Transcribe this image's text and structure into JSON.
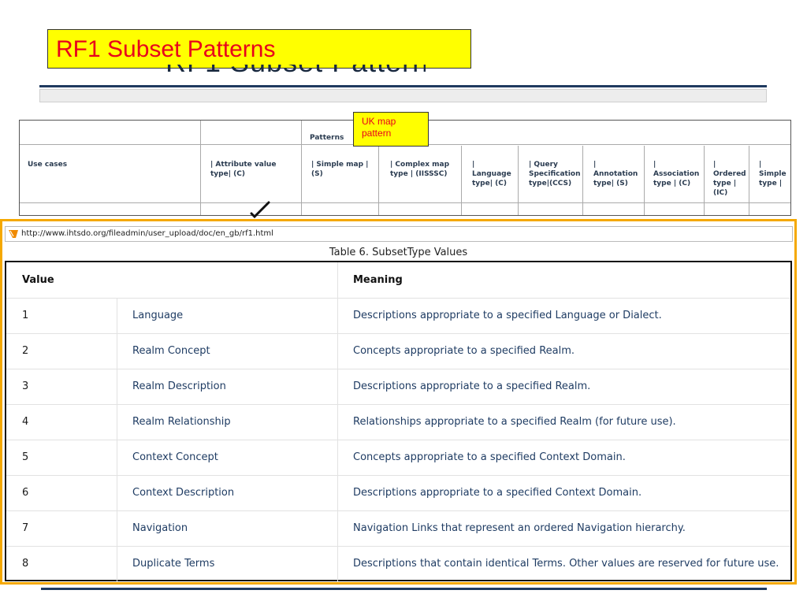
{
  "slide": {
    "title": "RF1 Subset Patterns",
    "colors": {
      "highlight": "#ffff00",
      "title_text": "#e8001c",
      "frame": "#f5a800",
      "rule": "#1f3a5f"
    }
  },
  "patterns_table": {
    "group_header": "Patterns",
    "headers": [
      "Use cases",
      "| Attribute value type| (C)",
      "| Simple map | (S)",
      "| Complex map type | (IISSSC)",
      "| Language type| (C)",
      "| Query Specification type|(CCS)",
      "| Annotation type| (S)",
      "| Association type | (C)",
      "| Ordered type | (IC)",
      "| Simple type |"
    ]
  },
  "uk_note": "UK map pattern",
  "browser": {
    "url": "http://www.ihtsdo.org/fileadmin/user_upload/doc/en_gb/rf1.html",
    "caption": "Table 6. SubsetType Values",
    "columns": {
      "value": "Value",
      "meaning": "Meaning"
    },
    "rows": [
      {
        "value": "1",
        "name": "Language",
        "meaning": "Descriptions appropriate to a specified Language or Dialect."
      },
      {
        "value": "2",
        "name": "Realm Concept",
        "meaning": "Concepts appropriate to a specified Realm."
      },
      {
        "value": "3",
        "name": "Realm Description",
        "meaning": "Descriptions appropriate to a specified Realm."
      },
      {
        "value": "4",
        "name": "Realm Relationship",
        "meaning": "Relationships appropriate to a specified Realm (for future use)."
      },
      {
        "value": "5",
        "name": "Context Concept",
        "meaning": "Concepts appropriate to a specified Context Domain."
      },
      {
        "value": "6",
        "name": "Context Description",
        "meaning": "Descriptions appropriate to a specified Context Domain."
      },
      {
        "value": "7",
        "name": "Navigation",
        "meaning": "Navigation Links that represent an ordered Navigation hierarchy."
      },
      {
        "value": "8",
        "name": "Duplicate Terms",
        "meaning": "Descriptions that contain identical Terms. Other values are reserved for future use."
      }
    ]
  }
}
